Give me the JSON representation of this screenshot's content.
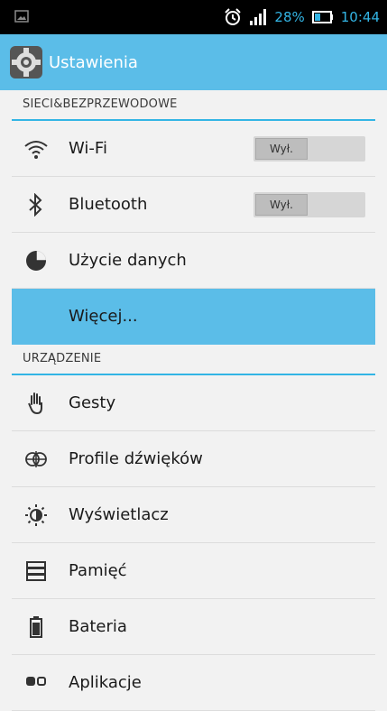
{
  "status_bar": {
    "battery_text": "28%",
    "time": "10:44",
    "icons": [
      "image-icon",
      "alarm-icon",
      "signal-icon",
      "battery-icon"
    ]
  },
  "action_bar": {
    "title": "Ustawienia",
    "icon": "settings-gear-icon",
    "accent_color": "#5bbde8"
  },
  "sections": [
    {
      "header": "SIECI&BEZPRZEWODOWE",
      "items": [
        {
          "label": "Wi-Fi",
          "icon": "wifi-icon",
          "toggle": "Wył."
        },
        {
          "label": "Bluetooth",
          "icon": "bluetooth-icon",
          "toggle": "Wył."
        },
        {
          "label": "Użycie danych",
          "icon": "data-usage-icon"
        },
        {
          "label": "Więcej...",
          "selected": true
        }
      ]
    },
    {
      "header": "URZĄDZENIE",
      "items": [
        {
          "label": "Gesty",
          "icon": "hand-gesture-icon"
        },
        {
          "label": "Profile dźwięków",
          "icon": "sound-profile-icon"
        },
        {
          "label": "Wyświetlacz",
          "icon": "brightness-icon"
        },
        {
          "label": "Pamięć",
          "icon": "storage-icon"
        },
        {
          "label": "Bateria",
          "icon": "battery-icon"
        },
        {
          "label": "Aplikacje",
          "icon": "apps-icon"
        }
      ]
    }
  ]
}
